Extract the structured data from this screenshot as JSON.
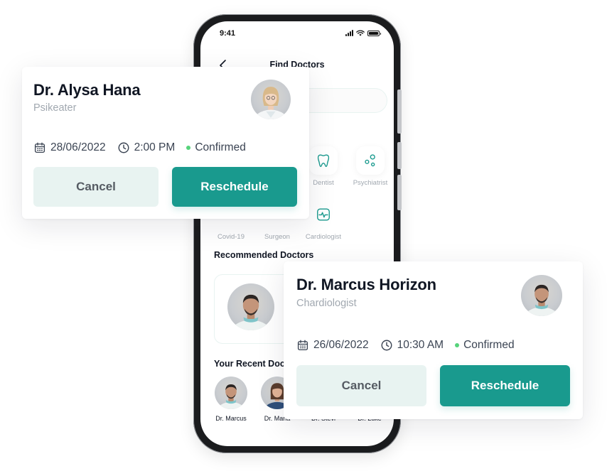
{
  "phone": {
    "status_time": "9:41",
    "nav_title": "Find Doctors",
    "categories": [
      {
        "label": "Dentist",
        "icon": "tooth-icon"
      },
      {
        "label": "Psychiatrist",
        "icon": "molecule-icon"
      },
      {
        "label": "Covid-19",
        "icon": "virus-icon"
      },
      {
        "label": "Surgeon",
        "icon": "scalpel-icon"
      },
      {
        "label": "Cardiologist",
        "icon": "heart-monitor-icon"
      }
    ],
    "recommended_title": "Recommended Doctors",
    "recent_title": "Your Recent Doctors",
    "recent_doctors": [
      "Dr. Marcus",
      "Dr. Maria",
      "Dr. Stevi",
      "Dr. Luke"
    ]
  },
  "card_top": {
    "name": "Dr. Alysa Hana",
    "specialty": "Psikeater",
    "date": "28/06/2022",
    "time": "2:00 PM",
    "status": "Confirmed",
    "cancel_label": "Cancel",
    "reschedule_label": "Reschedule"
  },
  "card_bottom": {
    "name": "Dr. Marcus Horizon",
    "specialty": "Chardiologist",
    "date": "26/06/2022",
    "time": "10:30 AM",
    "status": "Confirmed",
    "cancel_label": "Cancel",
    "reschedule_label": "Reschedule"
  },
  "colors": {
    "primary": "#199a8e",
    "cancel_bg": "#e8f3f1",
    "status_green": "#56d37b",
    "muted_text": "#a1a8b0"
  }
}
